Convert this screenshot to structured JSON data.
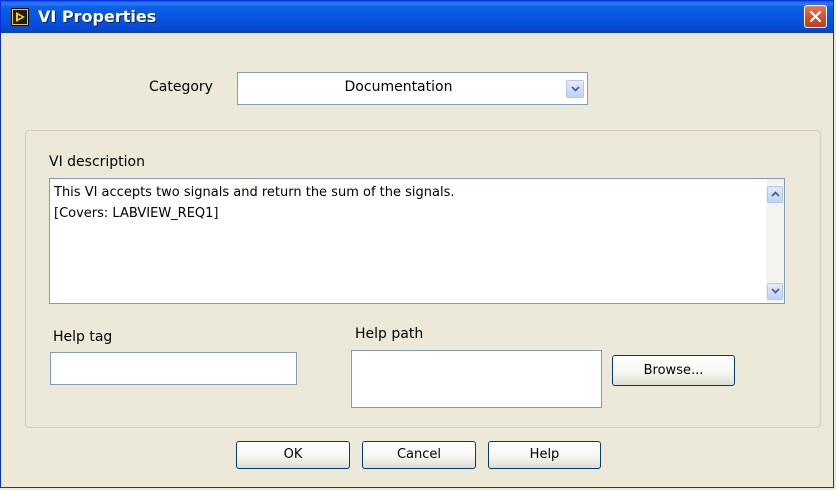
{
  "window": {
    "title": "VI Properties"
  },
  "category": {
    "label": "Category",
    "value": "Documentation"
  },
  "description": {
    "label": "VI description",
    "lines": [
      "This VI accepts two signals and return the sum of the signals.",
      "[Covers: LABVIEW_REQ1]"
    ]
  },
  "help_tag": {
    "label": "Help tag",
    "value": ""
  },
  "help_path": {
    "label": "Help path",
    "value": "",
    "browse_label": "Browse..."
  },
  "buttons": {
    "ok": "OK",
    "cancel": "Cancel",
    "help": "Help"
  },
  "colors": {
    "titlebar": "#0553df",
    "close": "#d8502e",
    "dialog_bg": "#ece9d8",
    "field_border": "#7f9db9"
  }
}
